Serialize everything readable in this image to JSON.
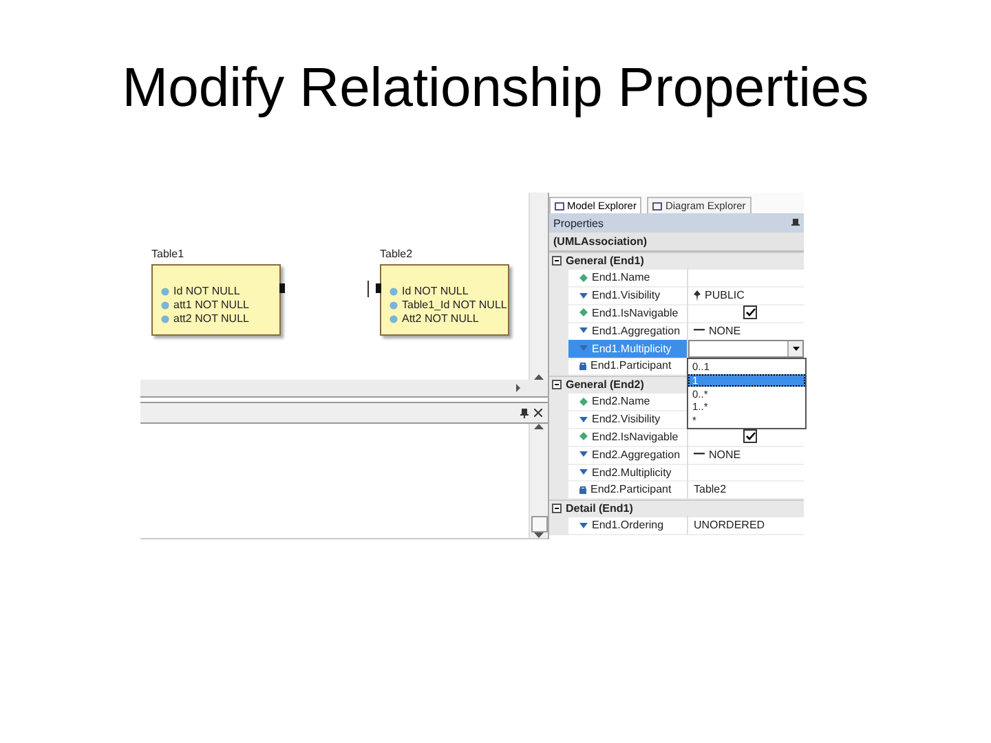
{
  "slide_title": "Modify Relationship Properties",
  "diagram": {
    "tables": [
      {
        "name": "Table1",
        "columns": [
          "Id NOT NULL",
          "att1 NOT NULL",
          "att2 NOT NULL"
        ]
      },
      {
        "name": "Table2",
        "columns": [
          "Id NOT NULL",
          "Table1_Id NOT NULL",
          "Att2 NOT NULL"
        ]
      }
    ]
  },
  "explorer_tabs": [
    {
      "label": "Model Explorer",
      "selected": true
    },
    {
      "label": "Diagram Explorer",
      "selected": false
    }
  ],
  "properties": {
    "title": "Properties",
    "object": "(UMLAssociation)",
    "groups": [
      {
        "label": "General (End1)",
        "expanded": true,
        "rows": [
          {
            "name": "End1.Name",
            "kind": "text",
            "selected": false
          },
          {
            "name": "End1.Visibility",
            "kind": "text",
            "value": "PUBLIC",
            "selected": false
          },
          {
            "name": "End1.IsNavigable",
            "kind": "checkbox",
            "checked": true,
            "selected": false
          },
          {
            "name": "End1.Aggregation",
            "kind": "text",
            "value": "NONE",
            "selected": false
          },
          {
            "name": "End1.Multiplicity",
            "kind": "dropdown",
            "selected": true
          },
          {
            "name": "End1.Participant",
            "kind": "text",
            "selected": false
          }
        ]
      },
      {
        "label": "General (End2)",
        "expanded": true,
        "rows": [
          {
            "name": "End2.Name",
            "kind": "text",
            "selected": false
          },
          {
            "name": "End2.Visibility",
            "kind": "text",
            "selected": false
          },
          {
            "name": "End2.IsNavigable",
            "kind": "checkbox",
            "checked": true,
            "selected": false
          },
          {
            "name": "End2.Aggregation",
            "kind": "text",
            "value": "NONE",
            "selected": false
          },
          {
            "name": "End2.Multiplicity",
            "kind": "text",
            "selected": false
          },
          {
            "name": "End2.Participant",
            "kind": "text",
            "value": "Table2",
            "selected": false
          }
        ]
      },
      {
        "label": "Detail (End1)",
        "expanded": true,
        "rows": [
          {
            "name": "End1.Ordering",
            "kind": "text",
            "value": "UNORDERED",
            "selected": false
          }
        ]
      }
    ],
    "dropdown_options": [
      {
        "label": "0..1",
        "selected": false
      },
      {
        "label": "1",
        "selected": true
      },
      {
        "label": "0..*",
        "selected": false
      },
      {
        "label": "1..*",
        "selected": false
      },
      {
        "label": "*",
        "selected": false
      }
    ]
  }
}
